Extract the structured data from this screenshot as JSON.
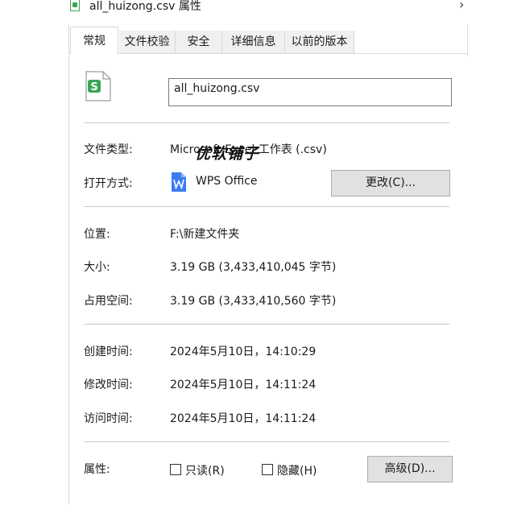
{
  "window": {
    "title": "all_huizong.csv 属性",
    "title_icon": "csv-file-icon",
    "chevron": "›"
  },
  "tabs": [
    {
      "label": "常规",
      "active": true
    },
    {
      "label": "文件校验"
    },
    {
      "label": "安全"
    },
    {
      "label": "详细信息"
    },
    {
      "label": "以前的版本"
    }
  ],
  "general": {
    "file_icon": "wps-spreadsheet-icon",
    "filename": "all_huizong.csv",
    "type_label": "文件类型:",
    "type_value": "Microsoft Excel 工作表 (.csv)",
    "watermark": "优软铺子",
    "opens_with_label": "打开方式:",
    "opens_with_app": "WPS Office",
    "opens_with_icon": "wps-writer-icon",
    "change_button": "更改(C)...",
    "location_label": "位置:",
    "location_value": "F:\\新建文件夹",
    "size_label": "大小:",
    "size_value": "3.19 GB (3,433,410,045 字节)",
    "size_on_disk_label": "占用空间:",
    "size_on_disk_value": "3.19 GB (3,433,410,560 字节)",
    "created_label": "创建时间:",
    "created_value": "2024年5月10日，14:10:29",
    "modified_label": "修改时间:",
    "modified_value": "2024年5月10日，14:11:24",
    "accessed_label": "访问时间:",
    "accessed_value": "2024年5月10日，14:11:24",
    "attributes_label": "属性:",
    "readonly_label": "只读(R)",
    "readonly_checked": false,
    "hidden_label": "隐藏(H)",
    "hidden_checked": false,
    "advanced_button": "高级(D)..."
  },
  "colors": {
    "accent_green": "#3aa657",
    "wps_blue": "#3b7cf0"
  }
}
